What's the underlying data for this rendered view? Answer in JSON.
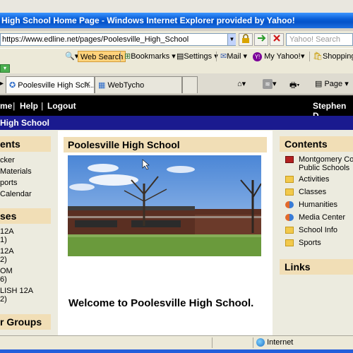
{
  "window": {
    "title": "High School Home Page - Windows Internet Explorer provided by Yahoo!"
  },
  "addressbar": {
    "url": "https://www.edline.net/pages/Poolesville_High_School",
    "search_placeholder": "Yahoo! Search"
  },
  "yahoo_toolbar": {
    "web_search": "Web Search",
    "bookmarks": "Bookmarks",
    "settings": "Settings",
    "mail": "Mail",
    "my_yahoo": "My Yahoo!",
    "shopping": "Shopping"
  },
  "tabs": [
    {
      "label": "Poolesville High Sch..."
    },
    {
      "label": "WebTycho"
    }
  ],
  "commands": {
    "page": "Page"
  },
  "site_nav": {
    "home": "me",
    "help": "Help",
    "logout": "Logout",
    "user": "Stephen D"
  },
  "school_bar": "High School",
  "left": {
    "contents_header": "ents",
    "links": [
      "cker",
      "Materials",
      "ports",
      "Calendar"
    ],
    "classes_header": "ses",
    "classes": [
      "12A",
      "1)",
      "12A",
      "2)",
      "OM",
      "6)",
      "LISH 12A",
      "2)"
    ],
    "groups_header": "r Groups"
  },
  "main": {
    "header": "Poolesville High School",
    "welcome": "Welcome to Poolesville High School."
  },
  "right": {
    "contents_header": "Contents",
    "items": [
      {
        "label": "Montgomery Cou",
        "label2": "Public Schools",
        "icon": "book-icon"
      },
      {
        "label": "Activities",
        "icon": "folder-icon"
      },
      {
        "label": "Classes",
        "icon": "folder-icon"
      },
      {
        "label": "Humanities",
        "icon": "people-icon"
      },
      {
        "label": "Media Center",
        "icon": "people-icon"
      },
      {
        "label": "School Info",
        "icon": "folder-icon"
      },
      {
        "label": "Sports",
        "icon": "folder-icon"
      }
    ],
    "links_header": "Links"
  },
  "status": {
    "zone": "Internet"
  }
}
